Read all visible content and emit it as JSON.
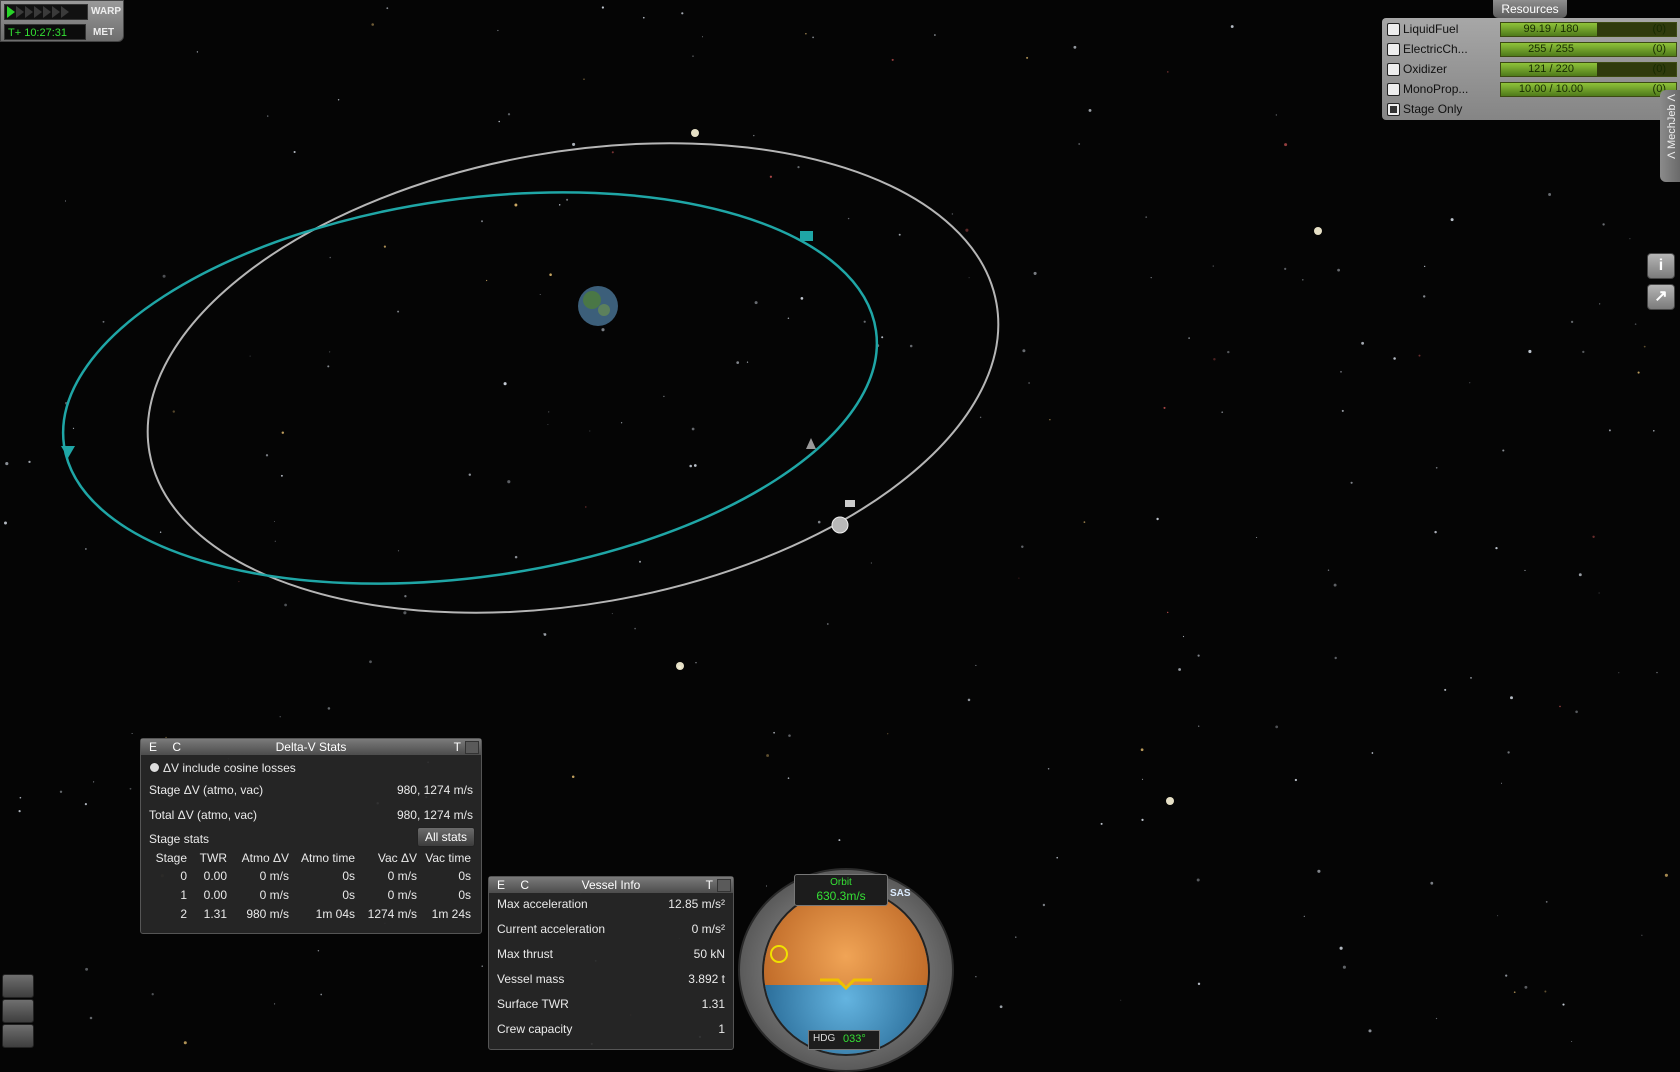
{
  "warp": {
    "label": "WARP",
    "arrows_lit": 1,
    "arrows_total": 7
  },
  "met": {
    "time": "T+ 10:27:31",
    "label": "MET"
  },
  "resources": {
    "title": "Resources",
    "items": [
      {
        "name": "LiquidFuel",
        "value": "99.19 / 180",
        "delta": "(0)",
        "fill": 0.551,
        "checked": false
      },
      {
        "name": "ElectricCh...",
        "value": "255 / 255",
        "delta": "(0)",
        "fill": 1.0,
        "checked": false
      },
      {
        "name": "Oxidizer",
        "value": "121 / 220",
        "delta": "(0)",
        "fill": 0.55,
        "checked": false
      },
      {
        "name": "MonoProp...",
        "value": "10.00 / 10.00",
        "delta": "(0)",
        "fill": 1.0,
        "checked": false
      }
    ],
    "stage_only": "Stage Only"
  },
  "mechjeb_tab": "Λ MechJeb Λ",
  "side_buttons": {
    "info": "i",
    "maneuver": "↗"
  },
  "delta_v": {
    "ec": "E C",
    "title": "Delta-V Stats",
    "t": "T",
    "cosine_label": "ΔV include cosine losses",
    "stage_dv_label": "Stage ΔV (atmo, vac)",
    "stage_dv_value": "980, 1274 m/s",
    "total_dv_label": "Total ΔV (atmo, vac)",
    "total_dv_value": "980, 1274 m/s",
    "stage_stats_label": "Stage stats",
    "all_stats_button": "All stats",
    "columns": [
      "Stage",
      "TWR",
      "Atmo ΔV",
      "Atmo time",
      "Vac ΔV",
      "Vac time"
    ],
    "rows": [
      [
        "0",
        "0.00",
        "0 m/s",
        "0s",
        "0 m/s",
        "0s"
      ],
      [
        "1",
        "0.00",
        "0 m/s",
        "0s",
        "0 m/s",
        "0s"
      ],
      [
        "2",
        "1.31",
        "980 m/s",
        "1m 04s",
        "1274 m/s",
        "1m 24s"
      ]
    ]
  },
  "vessel_info": {
    "ec": "E C",
    "title": "Vessel Info",
    "t": "T",
    "rows": [
      {
        "label": "Max acceleration",
        "value": "12.85 m/s²"
      },
      {
        "label": "Current acceleration",
        "value": "0 m/s²"
      },
      {
        "label": "Max thrust",
        "value": "50 kN"
      },
      {
        "label": "Vessel mass",
        "value": "3.892 t"
      },
      {
        "label": "Surface TWR",
        "value": "1.31"
      },
      {
        "label": "Crew capacity",
        "value": "1"
      }
    ]
  },
  "navball": {
    "mode": "Orbit",
    "speed": "630.3m/s",
    "sas": "SAS",
    "hdg_label": "HDG",
    "hdg_value": "033°"
  },
  "colors": {
    "orbit_current": "#1fa6a6",
    "orbit_target": "#d8d8d8",
    "fuel_bar": "#7fb437",
    "met_green": "#33e033"
  }
}
